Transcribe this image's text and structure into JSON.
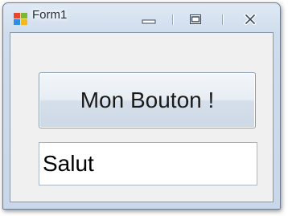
{
  "window": {
    "title": "Form1",
    "icon": "winforms-app-icon",
    "controls": {
      "minimize": "minimize-icon",
      "maximize": "maximize-icon",
      "close": "close-icon"
    }
  },
  "form": {
    "button_label": "Mon Bouton !",
    "textbox_value": "Salut"
  },
  "colors": {
    "client_background": "#f0f0f0",
    "frame": "#cfdcec"
  }
}
